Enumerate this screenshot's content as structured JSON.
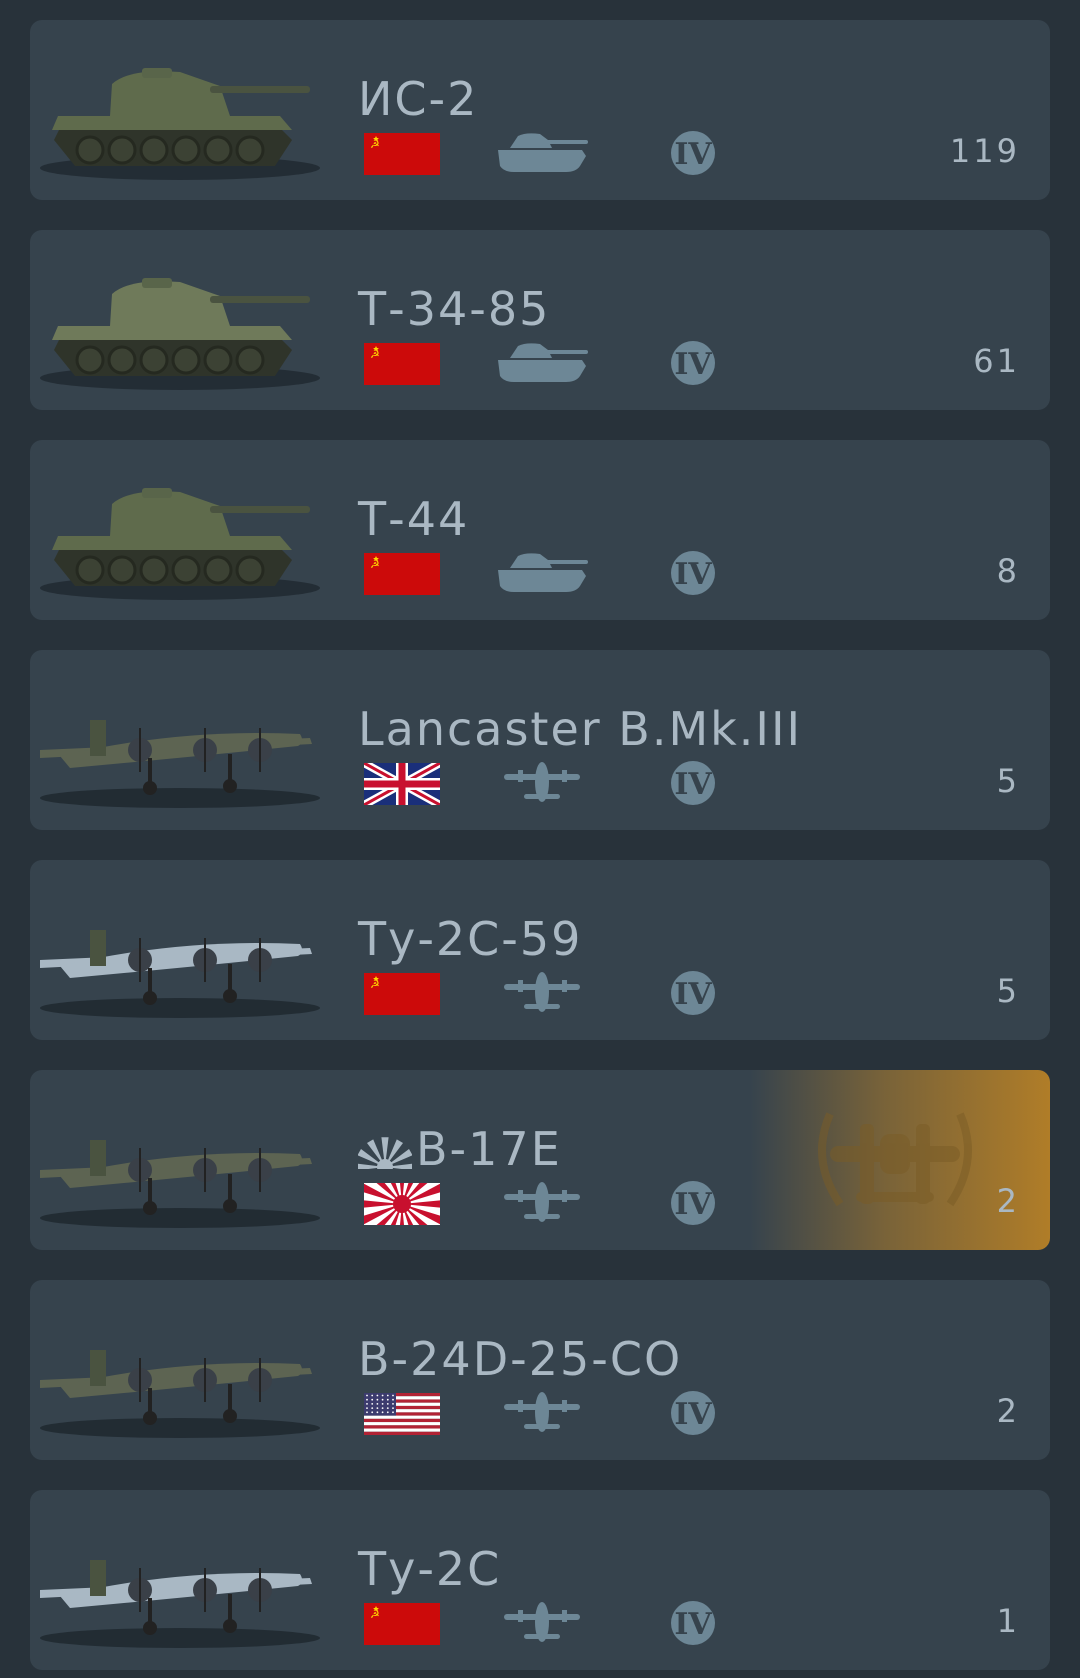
{
  "vehicles": [
    {
      "name": "ИС-2",
      "nation": "ussr",
      "type": "tank",
      "rank": "IV",
      "count": "119",
      "premium": false
    },
    {
      "name": "Т-34-85",
      "nation": "ussr",
      "type": "tank",
      "rank": "IV",
      "count": "61",
      "premium": false
    },
    {
      "name": "Т-44",
      "nation": "ussr",
      "type": "tank",
      "rank": "IV",
      "count": "8",
      "premium": false
    },
    {
      "name": "Lancaster B.Mk.III",
      "nation": "uk",
      "type": "bomber",
      "rank": "IV",
      "count": "5",
      "premium": false
    },
    {
      "name": "Ту-2С-59",
      "nation": "ussr",
      "type": "bomber",
      "rank": "IV",
      "count": "5",
      "premium": false
    },
    {
      "name": "B-17E",
      "nation": "japan",
      "type": "bomber",
      "rank": "IV",
      "count": "2",
      "premium": true,
      "name_prefix_icon": "japan-flag-prefix-icon"
    },
    {
      "name": "B-24D-25-CO",
      "nation": "usa",
      "type": "bomber",
      "rank": "IV",
      "count": "2",
      "premium": false
    },
    {
      "name": "Ту-2С",
      "nation": "ussr",
      "type": "bomber",
      "rank": "IV",
      "count": "1",
      "premium": false
    }
  ],
  "colors": {
    "background": "#28323a",
    "card": "#36434d",
    "text": "#aab8c3",
    "icon": "#6d8796",
    "premium_gold": "#b07d28",
    "ussr_red": "#cc0a0a"
  }
}
